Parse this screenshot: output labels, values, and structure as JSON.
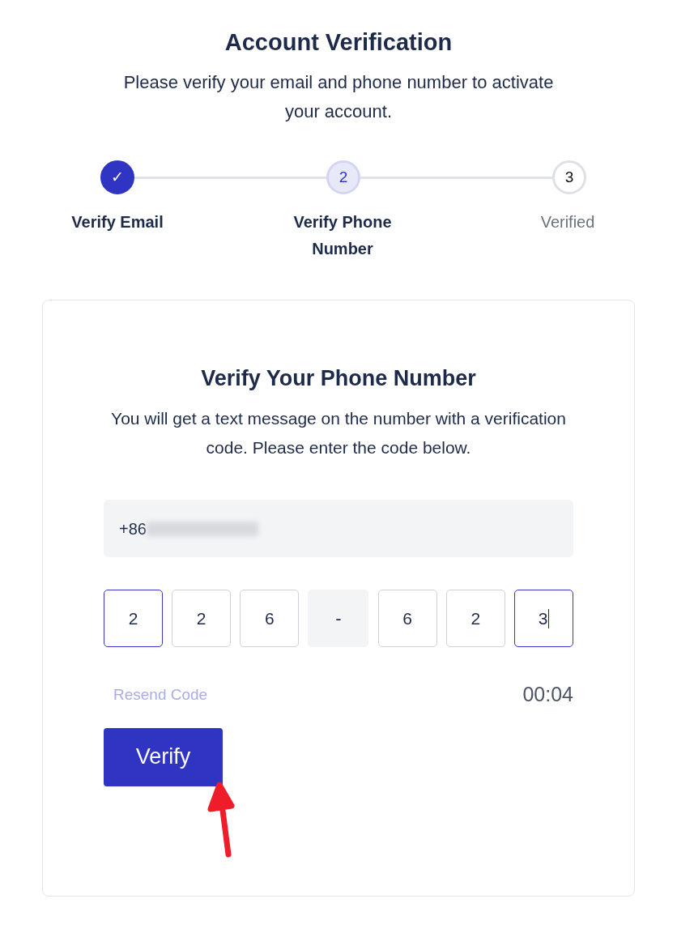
{
  "header": {
    "title": "Account Verification",
    "subtitle": "Please verify your email and phone number to activate your account."
  },
  "steps": [
    {
      "marker": "✓",
      "label": "Verify Email",
      "done": true,
      "selected": false
    },
    {
      "marker": "2",
      "label": "Verify Phone Number",
      "done": false,
      "selected": true
    },
    {
      "marker": "3",
      "label": "Verified",
      "done": false,
      "selected": false
    }
  ],
  "card": {
    "title": "Verify Your Phone Number",
    "description": "You will get a text message on the number with a verification code. Please enter the code below.",
    "phone_field": {
      "value": "+86",
      "redacted": true
    },
    "code": [
      {
        "kind": "digit",
        "value": "2",
        "highlighted": true,
        "cursor": false
      },
      {
        "kind": "digit",
        "value": "2",
        "highlighted": false,
        "cursor": false
      },
      {
        "kind": "digit",
        "value": "6",
        "highlighted": false,
        "cursor": false
      },
      {
        "kind": "separator",
        "value": "-"
      },
      {
        "kind": "digit",
        "value": "6",
        "highlighted": false,
        "cursor": false
      },
      {
        "kind": "digit",
        "value": "2",
        "highlighted": false,
        "cursor": false
      },
      {
        "kind": "digit",
        "value": "3",
        "highlighted": true,
        "cursor": true
      }
    ],
    "resend": {
      "label": "Resend Code",
      "disabled": true
    },
    "timer": "00:04",
    "verify_button": "Verify"
  }
}
